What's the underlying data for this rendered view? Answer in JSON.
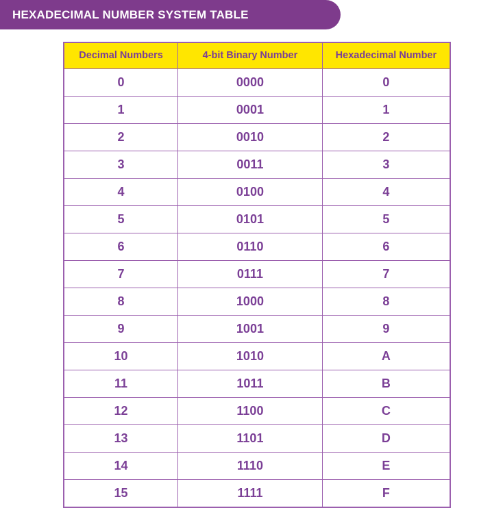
{
  "banner": {
    "title": "HEXADECIMAL NUMBER SYSTEM TABLE"
  },
  "colors": {
    "banner_purple": "#7e3b8c",
    "header_yellow": "#ffe600",
    "text_purple": "#7b3f96",
    "border_purple": "#9b5fae",
    "page_background": "#ffffff"
  },
  "table": {
    "columns": [
      "Decimal Numbers",
      "4-bit Binary Number",
      "Hexadecimal Number"
    ],
    "rows": [
      {
        "decimal": "0",
        "binary": "0000",
        "hex": "0"
      },
      {
        "decimal": "1",
        "binary": "0001",
        "hex": "1"
      },
      {
        "decimal": "2",
        "binary": "0010",
        "hex": "2"
      },
      {
        "decimal": "3",
        "binary": "0011",
        "hex": "3"
      },
      {
        "decimal": "4",
        "binary": "0100",
        "hex": "4"
      },
      {
        "decimal": "5",
        "binary": "0101",
        "hex": "5"
      },
      {
        "decimal": "6",
        "binary": "0110",
        "hex": "6"
      },
      {
        "decimal": "7",
        "binary": "0111",
        "hex": "7"
      },
      {
        "decimal": "8",
        "binary": "1000",
        "hex": "8"
      },
      {
        "decimal": "9",
        "binary": "1001",
        "hex": "9"
      },
      {
        "decimal": "10",
        "binary": "1010",
        "hex": "A"
      },
      {
        "decimal": "11",
        "binary": "1011",
        "hex": "B"
      },
      {
        "decimal": "12",
        "binary": "1100",
        "hex": "C"
      },
      {
        "decimal": "13",
        "binary": "1101",
        "hex": "D"
      },
      {
        "decimal": "14",
        "binary": "1110",
        "hex": "E"
      },
      {
        "decimal": "15",
        "binary": "1111",
        "hex": "F"
      }
    ]
  }
}
